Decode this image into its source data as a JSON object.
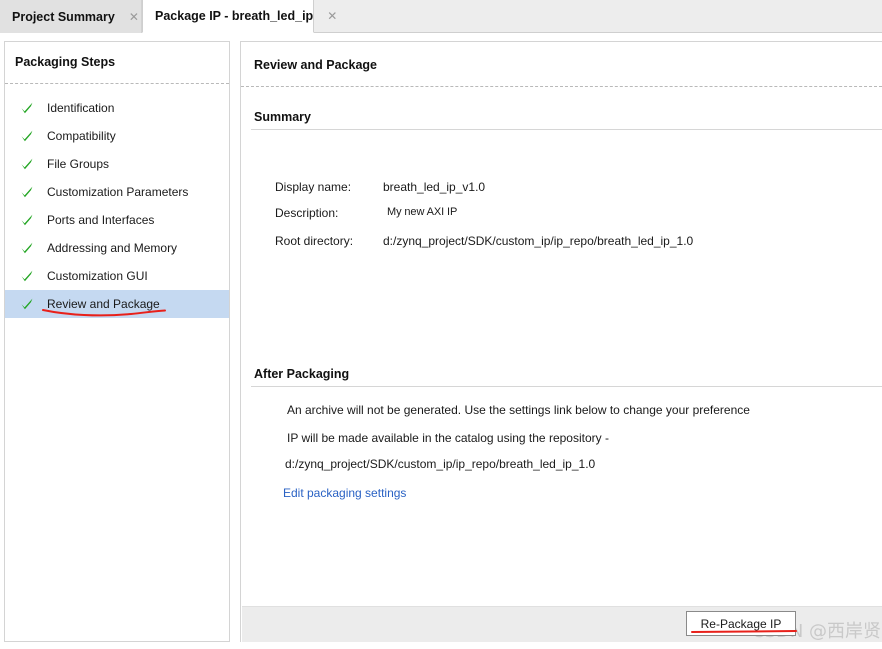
{
  "tabs": [
    {
      "label": "Project Summary",
      "close_icon": "close-icon",
      "active": false
    },
    {
      "label": "Package IP - breath_led_ip",
      "close_icon": "close-icon",
      "active": true
    }
  ],
  "sidebar": {
    "title": "Packaging Steps",
    "items": [
      {
        "label": "Identification",
        "status_icon": "check-icon",
        "selected": false
      },
      {
        "label": "Compatibility",
        "status_icon": "check-icon",
        "selected": false
      },
      {
        "label": "File Groups",
        "status_icon": "check-icon",
        "selected": false
      },
      {
        "label": "Customization Parameters",
        "status_icon": "check-icon",
        "selected": false
      },
      {
        "label": "Ports and Interfaces",
        "status_icon": "check-icon",
        "selected": false
      },
      {
        "label": "Addressing and Memory",
        "status_icon": "check-icon",
        "selected": false
      },
      {
        "label": "Customization GUI",
        "status_icon": "check-icon",
        "selected": false
      },
      {
        "label": "Review and Package",
        "status_icon": "check-icon",
        "selected": true
      }
    ]
  },
  "main": {
    "title": "Review and Package",
    "summary": {
      "heading": "Summary",
      "rows": [
        {
          "label": "Display name:",
          "value": "breath_led_ip_v1.0"
        },
        {
          "label": "Description:",
          "value": "My new AXI IP"
        },
        {
          "label": "Root directory:",
          "value": "d:/zynq_project/SDK/custom_ip/ip_repo/breath_led_ip_1.0"
        }
      ]
    },
    "after_packaging": {
      "heading": "After Packaging",
      "lines": [
        "An archive will not be generated. Use the settings link below to change your preference",
        "IP will be made available in the catalog using the repository -",
        "d:/zynq_project/SDK/custom_ip/ip_repo/breath_led_ip_1.0"
      ],
      "link_label": "Edit packaging settings"
    },
    "footer": {
      "repackage_label": "Re-Package IP"
    }
  },
  "annotations": {
    "watermark": "CSDN @西岸贤",
    "highlight_color": "#c5d9f1",
    "check_color": "#22a522",
    "underline_color": "#e8201a",
    "link_color": "#2a62c4"
  }
}
